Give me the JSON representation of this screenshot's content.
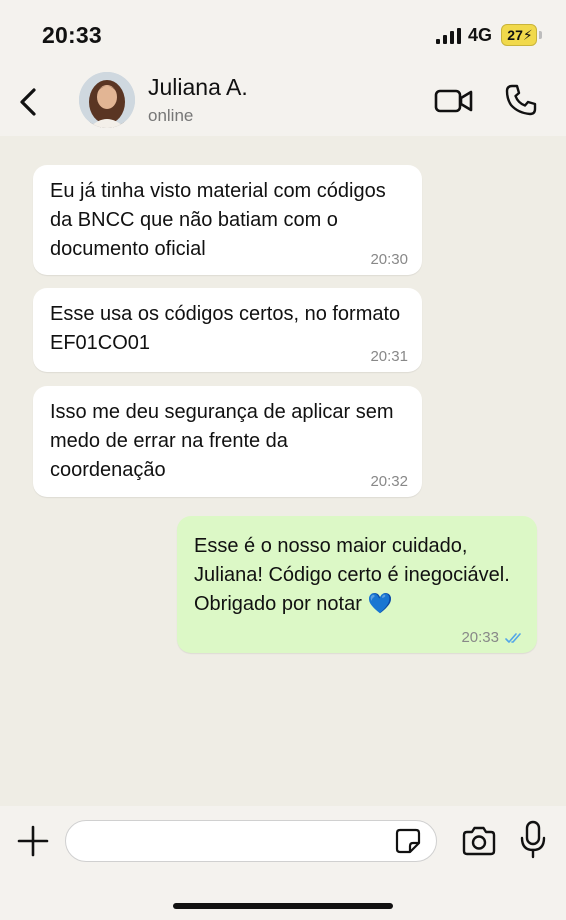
{
  "status_bar": {
    "time": "20:33",
    "network": "4G",
    "battery": "27"
  },
  "header": {
    "contact_name": "Juliana A.",
    "contact_status": "online",
    "icons": [
      "back-arrow-icon",
      "video-call-icon",
      "phone-icon"
    ]
  },
  "messages": [
    {
      "direction": "in",
      "text": "Eu já tinha visto material com códigos da BNCC que não batiam com o documento oficial",
      "time": "20:30"
    },
    {
      "direction": "in",
      "text": "Esse usa os códigos certos, no formato EF01CO01",
      "time": "20:31"
    },
    {
      "direction": "in",
      "text": "Isso me deu segurança de aplicar sem medo de errar na frente da coordenação",
      "time": "20:32"
    },
    {
      "direction": "out",
      "text": "Esse é o nosso maior cuidado, Juliana! Código certo é inegociável. Obrigado por notar 💙",
      "time": "20:33",
      "status": "read"
    }
  ],
  "composer": {
    "placeholder": "",
    "icons": [
      "plus-icon",
      "sticker-icon",
      "camera-icon",
      "microphone-icon"
    ]
  },
  "colors": {
    "incoming_bubble": "#ffffff",
    "outgoing_bubble": "#dcf8c6",
    "read_ticks": "#53a6e8",
    "battery": "#f1d94b"
  }
}
